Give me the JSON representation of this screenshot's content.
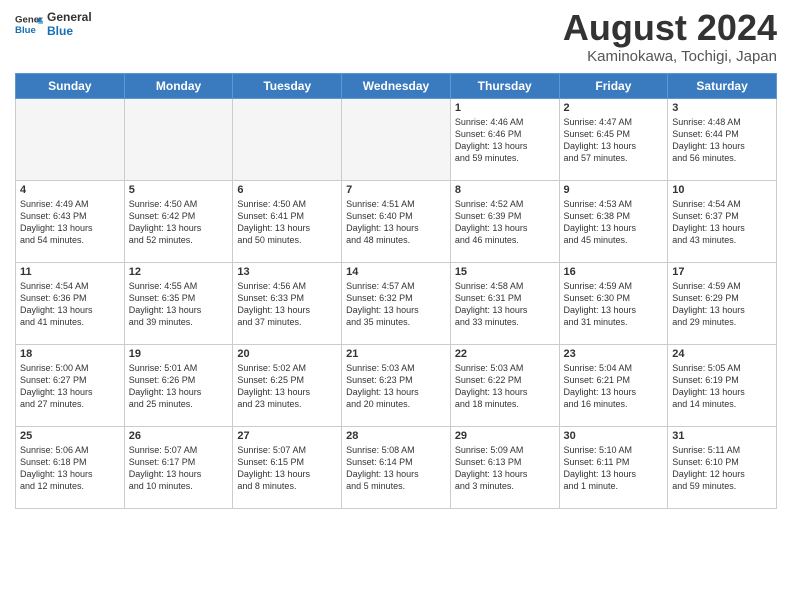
{
  "header": {
    "logo_line1": "General",
    "logo_line2": "Blue",
    "month_title": "August 2024",
    "location": "Kaminokawa, Tochigi, Japan"
  },
  "weekdays": [
    "Sunday",
    "Monday",
    "Tuesday",
    "Wednesday",
    "Thursday",
    "Friday",
    "Saturday"
  ],
  "weeks": [
    [
      {
        "day": "",
        "info": ""
      },
      {
        "day": "",
        "info": ""
      },
      {
        "day": "",
        "info": ""
      },
      {
        "day": "",
        "info": ""
      },
      {
        "day": "1",
        "info": "Sunrise: 4:46 AM\nSunset: 6:46 PM\nDaylight: 13 hours\nand 59 minutes."
      },
      {
        "day": "2",
        "info": "Sunrise: 4:47 AM\nSunset: 6:45 PM\nDaylight: 13 hours\nand 57 minutes."
      },
      {
        "day": "3",
        "info": "Sunrise: 4:48 AM\nSunset: 6:44 PM\nDaylight: 13 hours\nand 56 minutes."
      }
    ],
    [
      {
        "day": "4",
        "info": "Sunrise: 4:49 AM\nSunset: 6:43 PM\nDaylight: 13 hours\nand 54 minutes."
      },
      {
        "day": "5",
        "info": "Sunrise: 4:50 AM\nSunset: 6:42 PM\nDaylight: 13 hours\nand 52 minutes."
      },
      {
        "day": "6",
        "info": "Sunrise: 4:50 AM\nSunset: 6:41 PM\nDaylight: 13 hours\nand 50 minutes."
      },
      {
        "day": "7",
        "info": "Sunrise: 4:51 AM\nSunset: 6:40 PM\nDaylight: 13 hours\nand 48 minutes."
      },
      {
        "day": "8",
        "info": "Sunrise: 4:52 AM\nSunset: 6:39 PM\nDaylight: 13 hours\nand 46 minutes."
      },
      {
        "day": "9",
        "info": "Sunrise: 4:53 AM\nSunset: 6:38 PM\nDaylight: 13 hours\nand 45 minutes."
      },
      {
        "day": "10",
        "info": "Sunrise: 4:54 AM\nSunset: 6:37 PM\nDaylight: 13 hours\nand 43 minutes."
      }
    ],
    [
      {
        "day": "11",
        "info": "Sunrise: 4:54 AM\nSunset: 6:36 PM\nDaylight: 13 hours\nand 41 minutes."
      },
      {
        "day": "12",
        "info": "Sunrise: 4:55 AM\nSunset: 6:35 PM\nDaylight: 13 hours\nand 39 minutes."
      },
      {
        "day": "13",
        "info": "Sunrise: 4:56 AM\nSunset: 6:33 PM\nDaylight: 13 hours\nand 37 minutes."
      },
      {
        "day": "14",
        "info": "Sunrise: 4:57 AM\nSunset: 6:32 PM\nDaylight: 13 hours\nand 35 minutes."
      },
      {
        "day": "15",
        "info": "Sunrise: 4:58 AM\nSunset: 6:31 PM\nDaylight: 13 hours\nand 33 minutes."
      },
      {
        "day": "16",
        "info": "Sunrise: 4:59 AM\nSunset: 6:30 PM\nDaylight: 13 hours\nand 31 minutes."
      },
      {
        "day": "17",
        "info": "Sunrise: 4:59 AM\nSunset: 6:29 PM\nDaylight: 13 hours\nand 29 minutes."
      }
    ],
    [
      {
        "day": "18",
        "info": "Sunrise: 5:00 AM\nSunset: 6:27 PM\nDaylight: 13 hours\nand 27 minutes."
      },
      {
        "day": "19",
        "info": "Sunrise: 5:01 AM\nSunset: 6:26 PM\nDaylight: 13 hours\nand 25 minutes."
      },
      {
        "day": "20",
        "info": "Sunrise: 5:02 AM\nSunset: 6:25 PM\nDaylight: 13 hours\nand 23 minutes."
      },
      {
        "day": "21",
        "info": "Sunrise: 5:03 AM\nSunset: 6:23 PM\nDaylight: 13 hours\nand 20 minutes."
      },
      {
        "day": "22",
        "info": "Sunrise: 5:03 AM\nSunset: 6:22 PM\nDaylight: 13 hours\nand 18 minutes."
      },
      {
        "day": "23",
        "info": "Sunrise: 5:04 AM\nSunset: 6:21 PM\nDaylight: 13 hours\nand 16 minutes."
      },
      {
        "day": "24",
        "info": "Sunrise: 5:05 AM\nSunset: 6:19 PM\nDaylight: 13 hours\nand 14 minutes."
      }
    ],
    [
      {
        "day": "25",
        "info": "Sunrise: 5:06 AM\nSunset: 6:18 PM\nDaylight: 13 hours\nand 12 minutes."
      },
      {
        "day": "26",
        "info": "Sunrise: 5:07 AM\nSunset: 6:17 PM\nDaylight: 13 hours\nand 10 minutes."
      },
      {
        "day": "27",
        "info": "Sunrise: 5:07 AM\nSunset: 6:15 PM\nDaylight: 13 hours\nand 8 minutes."
      },
      {
        "day": "28",
        "info": "Sunrise: 5:08 AM\nSunset: 6:14 PM\nDaylight: 13 hours\nand 5 minutes."
      },
      {
        "day": "29",
        "info": "Sunrise: 5:09 AM\nSunset: 6:13 PM\nDaylight: 13 hours\nand 3 minutes."
      },
      {
        "day": "30",
        "info": "Sunrise: 5:10 AM\nSunset: 6:11 PM\nDaylight: 13 hours\nand 1 minute."
      },
      {
        "day": "31",
        "info": "Sunrise: 5:11 AM\nSunset: 6:10 PM\nDaylight: 12 hours\nand 59 minutes."
      }
    ]
  ]
}
